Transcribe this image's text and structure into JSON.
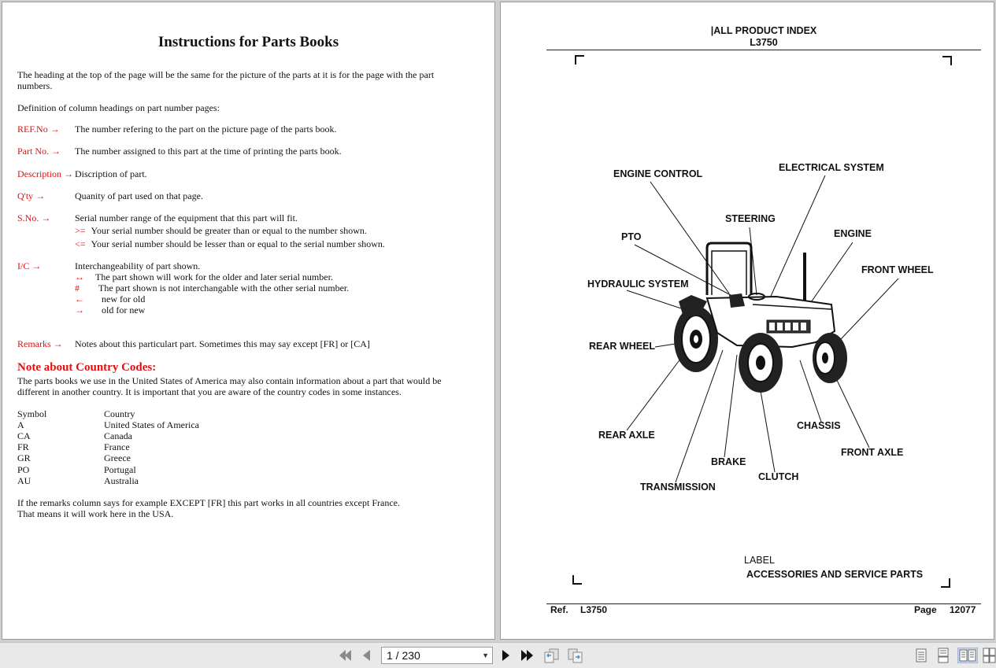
{
  "left_page": {
    "title": "Instructions for Parts Books",
    "intro_line1": "The heading at the top of the page will be the same for the picture of the parts at it is for the page with the part",
    "intro_line2": "numbers.",
    "definitions_heading": "Definition of column headings on part number pages:",
    "arrow_symbol": "→",
    "terms": {
      "ref": {
        "term": "REF.No",
        "desc": "The number refering to the part on the picture page of the parts book."
      },
      "part": {
        "term": "Part No.",
        "desc": "The number assigned to this part at the time of printing the parts book."
      },
      "description": {
        "term": "Description",
        "desc": "Discription of part."
      },
      "qty": {
        "term": "Q'ty",
        "desc": "Quanity of part used on that page."
      },
      "sno": {
        "term": "S.No.",
        "desc": "Serial number range of the equipment that this part will fit.",
        "ge_symbol": ">=",
        "ge_text": "Your serial number should be greater than or equal to the number shown.",
        "le_symbol": "<=",
        "le_text": "Your serial number should be lesser than or equal to the serial number shown."
      },
      "ic": {
        "term": "I/C",
        "desc": "Interchangeability of part shown.",
        "both_symbol": "↔",
        "both_text": "The part shown will work for the older and later serial number.",
        "hash_symbol": "#",
        "hash_text": "The part shown is not interchangable with the other serial number.",
        "left_symbol": "←",
        "left_text": "new for old",
        "right_symbol": "→",
        "right_text": "old for new"
      },
      "remarks": {
        "term": "Remarks",
        "desc": "Notes about this particulart part. Sometimes this may say except [FR] or [CA]"
      }
    },
    "country_note_title": "Note about Country Codes:",
    "country_note_line1": "The parts books we use in the United States of America may also contain information about a part that would be",
    "country_note_line2": "different in another country. It is important that you are aware of the country codes in some instances.",
    "codes_header": {
      "symbol": "Symbol",
      "country": "Country"
    },
    "codes": [
      {
        "symbol": "A",
        "country": "United States of America"
      },
      {
        "symbol": "CA",
        "country": "Canada"
      },
      {
        "symbol": "FR",
        "country": "France"
      },
      {
        "symbol": "GR",
        "country": "Greece"
      },
      {
        "symbol": "PO",
        "country": "Portugal"
      },
      {
        "symbol": "AU",
        "country": "Australia"
      }
    ],
    "closing_line1": "If the remarks column says for example EXCEPT [FR] this part works in all countries except France.",
    "closing_line2": "That means it will work here in the USA."
  },
  "right_page": {
    "header_line1": "|ALL PRODUCT INDEX",
    "header_line2": "L3750",
    "labels": {
      "engine_control": "ENGINE CONTROL",
      "electrical_system": "ELECTRICAL SYSTEM",
      "steering": "STEERING",
      "pto": "PTO",
      "engine": "ENGINE",
      "front_wheel": "FRONT WHEEL",
      "hydraulic_system": "HYDRAULIC SYSTEM",
      "rear_wheel": "REAR WHEEL",
      "rear_axle": "REAR AXLE",
      "chassis": "CHASSIS",
      "front_axle": "FRONT AXLE",
      "brake": "BRAKE",
      "clutch": "CLUTCH",
      "transmission": "TRANSMISSION"
    },
    "bottom_label1": "LABEL",
    "bottom_label2": "ACCESSORIES AND SERVICE PARTS",
    "footer": {
      "ref_label": "Ref.",
      "ref_value": "L3750",
      "page_label": "Page",
      "page_value": "12077"
    }
  },
  "toolbar": {
    "current_page": "1 / 230",
    "icons": [
      "first-page-icon",
      "previous-page-icon",
      "next-page-icon",
      "last-page-icon",
      "go-back-icon",
      "go-forward-icon",
      "single-page-view-icon",
      "continuous-view-icon",
      "two-page-view-icon",
      "two-page-continuous-icon"
    ]
  }
}
